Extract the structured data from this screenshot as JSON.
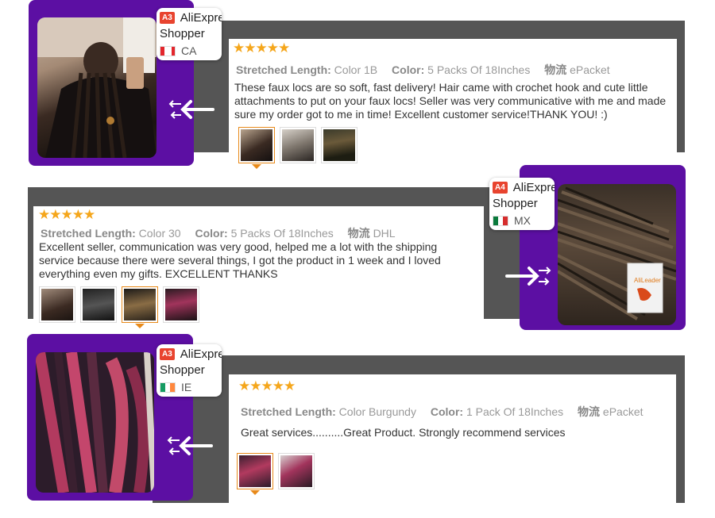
{
  "reviews": [
    {
      "badge": {
        "level": "A3",
        "brand": "AliExpre",
        "kind": "Shopper",
        "country": "CA"
      },
      "stars": "★★★★★",
      "length_label": "Stretched Length:",
      "length_value": "Color 1B",
      "color_label": "Color:",
      "color_value": "5 Packs Of 18Inches",
      "ship_label": "物流",
      "ship_value": "ePacket",
      "text": "These faux locs are so soft, fast delivery! Hair came with crochet hook and cute little attachments to put on your faux locs! Seller was very communicative with me and made sure my order got to me in time! Excellent customer service!THANK YOU! :)"
    },
    {
      "badge": {
        "level": "A4",
        "brand": "AliExpre",
        "kind": "Shopper",
        "country": "MX"
      },
      "stars": "★★★★★",
      "length_label": "Stretched Length:",
      "length_value": "Color 30",
      "color_label": "Color:",
      "color_value": "5 Packs Of 18Inches",
      "ship_label": "物流",
      "ship_value": "DHL",
      "text": "Excellent seller, communication was very good, helped me a lot with the shipping service because there were several things, I got the product in 1 week and I loved  everything even my gifts. EXCELLENT THANKS",
      "product_label": "AliLeader"
    },
    {
      "badge": {
        "level": "A3",
        "brand": "AliExpre",
        "kind": "Shopper",
        "country": "IE"
      },
      "stars": "★★★★★",
      "length_label": "Stretched Length:",
      "length_value": "Color Burgundy",
      "color_label": "Color:",
      "color_value": "1 Pack Of 18Inches",
      "ship_label": "物流",
      "ship_value": "ePacket",
      "text": "Great services..........Great Product. Strongly recommend services"
    }
  ],
  "colors": {
    "frame": "#5c0fa3",
    "dark": "#555555",
    "star": "#f5a61b",
    "badge": "#e8442f",
    "selected": "#e88a1a"
  },
  "icons": [
    "arrow-left-icon",
    "arrow-right-icon",
    "star-icon",
    "flag-icon"
  ]
}
